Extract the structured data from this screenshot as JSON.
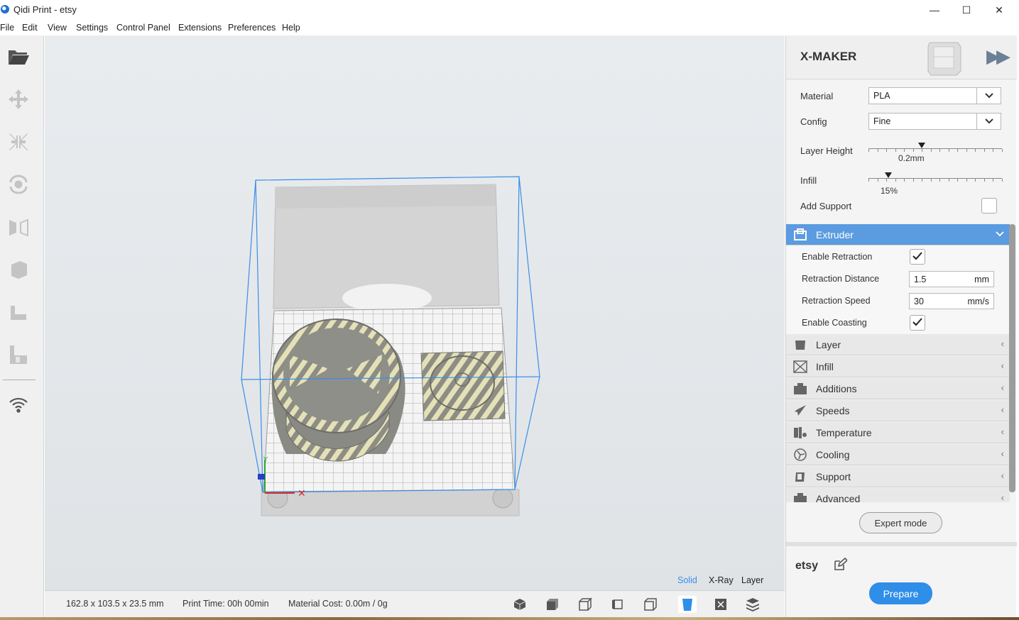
{
  "window": {
    "title": "Qidi Print - etsy",
    "minimize": "—",
    "maximize": "☐",
    "close": "✕"
  },
  "menu": [
    "File",
    "Edit",
    "View",
    "Settings",
    "Control Panel",
    "Extensions",
    "Preferences",
    "Help"
  ],
  "left_toolbar": [
    "open-folder-icon",
    "move-icon",
    "scale-icon",
    "rotate-icon",
    "mirror-icon",
    "per-model-settings-icon",
    "support-blocker-icon",
    "support-blocker-2-icon",
    "wifi-icon"
  ],
  "viewport": {
    "view_modes": [
      "Solid",
      "X-Ray",
      "Layer"
    ],
    "active_view_mode": "Solid",
    "accent": "#3a8ee6"
  },
  "status": {
    "dimensions": "162.8 x 103.5 x 23.5 mm",
    "print_time": "Print Time: 00h 00min",
    "material_cost": "Material Cost: 0.00m / 0g"
  },
  "camera_buttons": [
    "3d-view-icon",
    "front-view-icon",
    "top-view-icon",
    "left-view-icon",
    "right-view-icon",
    "solid-view-icon",
    "xray-view-icon",
    "layer-view-icon"
  ],
  "panel": {
    "printer": "X-MAKER",
    "material_label": "Material",
    "material_value": "PLA",
    "config_label": "Config",
    "config_value": "Fine",
    "layer_height_label": "Layer Height",
    "layer_height_value": "0.2mm",
    "layer_height_position": 0.4,
    "infill_label": "Infill",
    "infill_value": "15%",
    "infill_position": 0.15,
    "add_support_label": "Add Support",
    "add_support_checked": false,
    "sections": [
      {
        "title": "Extruder",
        "icon": "extruder-icon",
        "expanded": true
      },
      {
        "title": "Layer",
        "icon": "layer-icon",
        "expanded": false
      },
      {
        "title": "Infill",
        "icon": "infill-icon",
        "expanded": false
      },
      {
        "title": "Additions",
        "icon": "additions-icon",
        "expanded": false
      },
      {
        "title": "Speeds",
        "icon": "speeds-icon",
        "expanded": false
      },
      {
        "title": "Temperature",
        "icon": "temperature-icon",
        "expanded": false
      },
      {
        "title": "Cooling",
        "icon": "cooling-icon",
        "expanded": false
      },
      {
        "title": "Support",
        "icon": "support-icon",
        "expanded": false
      },
      {
        "title": "Advanced",
        "icon": "advanced-icon",
        "expanded": false
      }
    ],
    "extruder": {
      "enable_retraction_label": "Enable Retraction",
      "enable_retraction": true,
      "retraction_distance_label": "Retraction Distance",
      "retraction_distance": "1.5",
      "retraction_distance_unit": "mm",
      "retraction_speed_label": "Retraction Speed",
      "retraction_speed": "30",
      "retraction_speed_unit": "mm/s",
      "enable_coasting_label": "Enable Coasting",
      "enable_coasting": true
    },
    "expert_mode": "Expert mode",
    "project_name": "etsy",
    "prepare": "Prepare",
    "prepare_color": "#2f8ee8"
  }
}
